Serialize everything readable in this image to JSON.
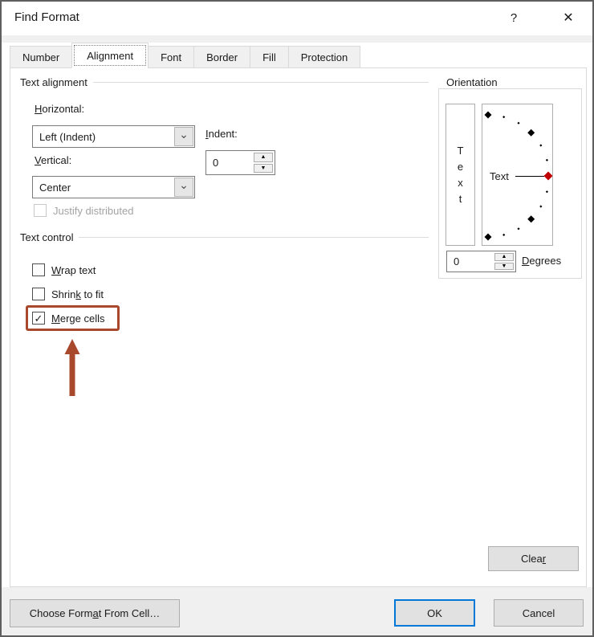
{
  "colors": {
    "accent": "#0078d7",
    "annotation": "#a8492e",
    "gauge_red": "#c00000"
  },
  "icons": {
    "help": "?",
    "close": "✕",
    "chevron_down": "⌄",
    "spinner_up": "▲",
    "spinner_down": "▼"
  },
  "window": {
    "title": "Find Format"
  },
  "tabs": [
    {
      "label": "Number",
      "active": false
    },
    {
      "label": "Alignment",
      "active": true
    },
    {
      "label": "Font",
      "active": false
    },
    {
      "label": "Border",
      "active": false
    },
    {
      "label": "Fill",
      "active": false
    },
    {
      "label": "Protection",
      "active": false
    }
  ],
  "text_alignment": {
    "group_label": "Text alignment",
    "horizontal_label": {
      "pre": "",
      "accel": "H",
      "post": "orizontal:"
    },
    "horizontal_value": "Left (Indent)",
    "indent_label": {
      "pre": "",
      "accel": "I",
      "post": "ndent:"
    },
    "indent_value": "0",
    "vertical_label": {
      "pre": "",
      "accel": "V",
      "post": "ertical:"
    },
    "vertical_value": "Center",
    "justify_distributed_label": "Justify distributed",
    "justify_distributed_checked": false,
    "justify_distributed_disabled": true
  },
  "text_control": {
    "group_label": "Text control",
    "checkboxes": [
      {
        "pre": "",
        "accel": "W",
        "post": "rap text",
        "checked": false,
        "glyph": "",
        "highlighted": false
      },
      {
        "pre": "Shrin",
        "accel": "k",
        "post": " to fit",
        "checked": false,
        "glyph": "",
        "highlighted": false
      },
      {
        "pre": "",
        "accel": "M",
        "post": "erge cells",
        "checked": true,
        "glyph": "✓",
        "highlighted": true
      }
    ]
  },
  "orientation": {
    "group_label": "Orientation",
    "letters": [
      "T",
      "e",
      "x",
      "t"
    ],
    "gauge_label": "Text",
    "degrees_value": "0",
    "degrees_label": {
      "pre": "",
      "accel": "D",
      "post": "egrees"
    }
  },
  "buttons": {
    "clear": {
      "pre": "Clea",
      "accel": "r",
      "post": ""
    },
    "choose_format": {
      "pre": "Choose Form",
      "accel": "a",
      "post": "t From Cell…"
    },
    "ok": "OK",
    "cancel": "Cancel"
  }
}
